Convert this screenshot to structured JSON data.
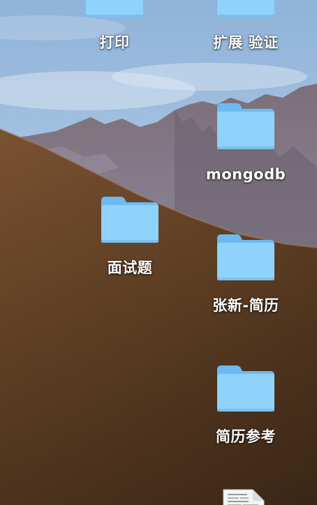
{
  "desktop": {
    "icons": [
      {
        "label": "打印",
        "icon": "folder-icon"
      },
      {
        "label": "扩展 验证",
        "icon": "folder-icon"
      },
      {
        "label": "mongodb",
        "icon": "folder-icon"
      },
      {
        "label": "面试题",
        "icon": "folder-icon"
      },
      {
        "label": "张新-简历",
        "icon": "folder-icon"
      },
      {
        "label": "简历参考",
        "icon": "folder-icon"
      }
    ],
    "partial_file_icon": "document-icon"
  },
  "colors": {
    "folder_light": "#8fd2fb",
    "folder_dark": "#6dbaf0",
    "sky": "#a9c6e4",
    "dune": "#6e4a2a"
  }
}
